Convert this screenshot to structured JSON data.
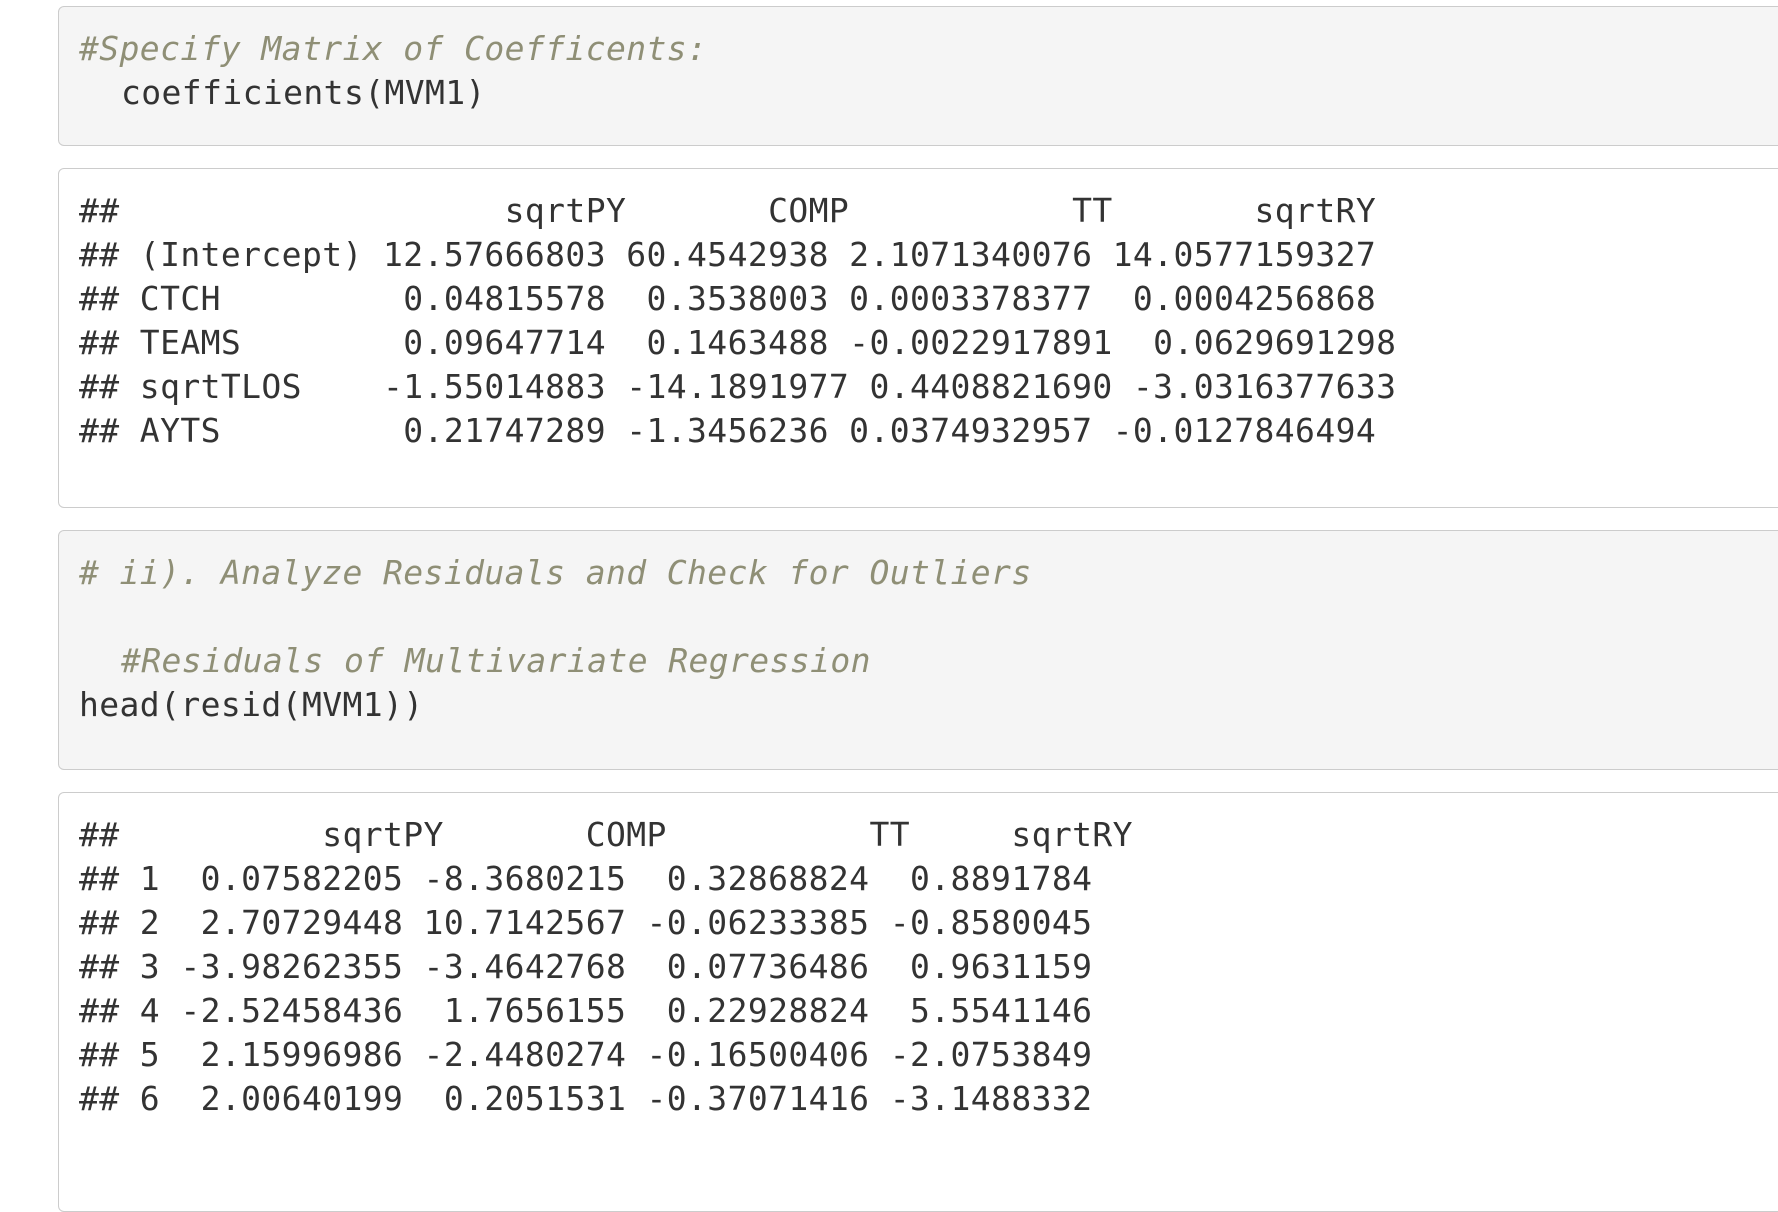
{
  "code_block_1": {
    "comment": "#Specify Matrix of Coefficents:",
    "code": "coefficients(MVM1)"
  },
  "coef_output": {
    "lines": [
      "##                   sqrtPY       COMP           TT       sqrtRY",
      "## (Intercept) 12.57666803 60.4542938 2.1071340076 14.0577159327",
      "## CTCH         0.04815578  0.3538003 0.0003378377  0.0004256868",
      "## TEAMS        0.09647714  0.1463488 -0.0022917891  0.0629691298",
      "## sqrtTLOS    -1.55014883 -14.1891977 0.4408821690 -3.0316377633",
      "## AYTS         0.21747289 -1.3456236 0.0374932957 -0.0127846494"
    ]
  },
  "code_block_2": {
    "comment_1": "# ii). Analyze Residuals and Check for Outliers",
    "comment_2": "#Residuals of Multivariate Regression",
    "code": "head(resid(MVM1))"
  },
  "resid_output": {
    "lines": [
      "##          sqrtPY       COMP          TT     sqrtRY",
      "## 1  0.07582205 -8.3680215  0.32868824  0.8891784",
      "## 2  2.70729448 10.7142567 -0.06233385 -0.8580045",
      "## 3 -3.98262355 -3.4642768  0.07736486  0.9631159",
      "## 4 -2.52458436  1.7656155  0.22928824  5.5541146",
      "## 5  2.15996986 -2.4480274 -0.16500406 -2.0753849",
      "## 6  2.00640199  0.2051531 -0.37071416 -3.1488332"
    ]
  }
}
